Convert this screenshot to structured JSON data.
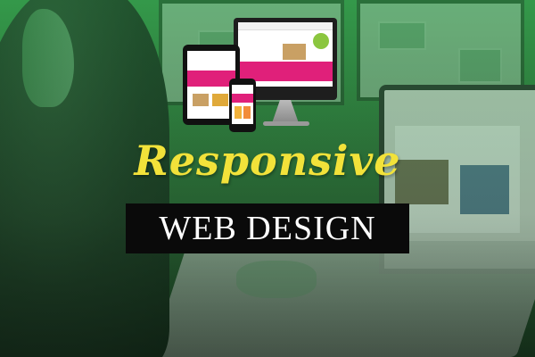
{
  "banner": {
    "headline": "Responsive",
    "subtitle": "WEB DESIGN"
  },
  "colors": {
    "headline": "#f2e23a",
    "subtitle_text": "#ffffff",
    "subtitle_box": "#0a0a0a",
    "overlay_green": "#3a9a4c",
    "accent_pink": "#e0207a",
    "accent_green": "#8bc63f"
  },
  "icons": [
    "desktop-monitor-icon",
    "tablet-icon",
    "smartphone-icon"
  ]
}
